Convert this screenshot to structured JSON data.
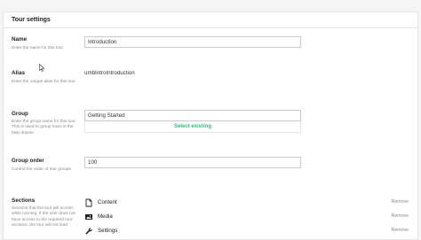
{
  "panel": {
    "title": "Tour settings"
  },
  "fields": {
    "name": {
      "label": "Name",
      "description": "Enter the name for this tour",
      "value": "Introduction"
    },
    "alias": {
      "label": "Alias",
      "description": "Enter the unique alias for this tour",
      "value": "umbIntroIntroduction"
    },
    "group": {
      "label": "Group",
      "description": "Enter the group name for this tour. This is used to group tours in the help drawer",
      "value": "Getting Started",
      "select_existing": "Select existing"
    },
    "group_order": {
      "label": "Group order",
      "description": "Control the order of tour groups",
      "value": "100"
    },
    "sections": {
      "label": "Sections",
      "description": "Sections that the tour will access while running, if the user does not have access to the required tour sections, the tour will not load",
      "items": [
        {
          "name": "Content",
          "icon": "document-icon",
          "remove_label": "Remove"
        },
        {
          "name": "Media",
          "icon": "picture-icon",
          "remove_label": "Remove"
        },
        {
          "name": "Settings",
          "icon": "wrench-icon",
          "remove_label": "Remove"
        }
      ]
    }
  },
  "colors": {
    "accent": "#2bc37c",
    "border": "#c9c9ce",
    "muted": "#888888"
  }
}
